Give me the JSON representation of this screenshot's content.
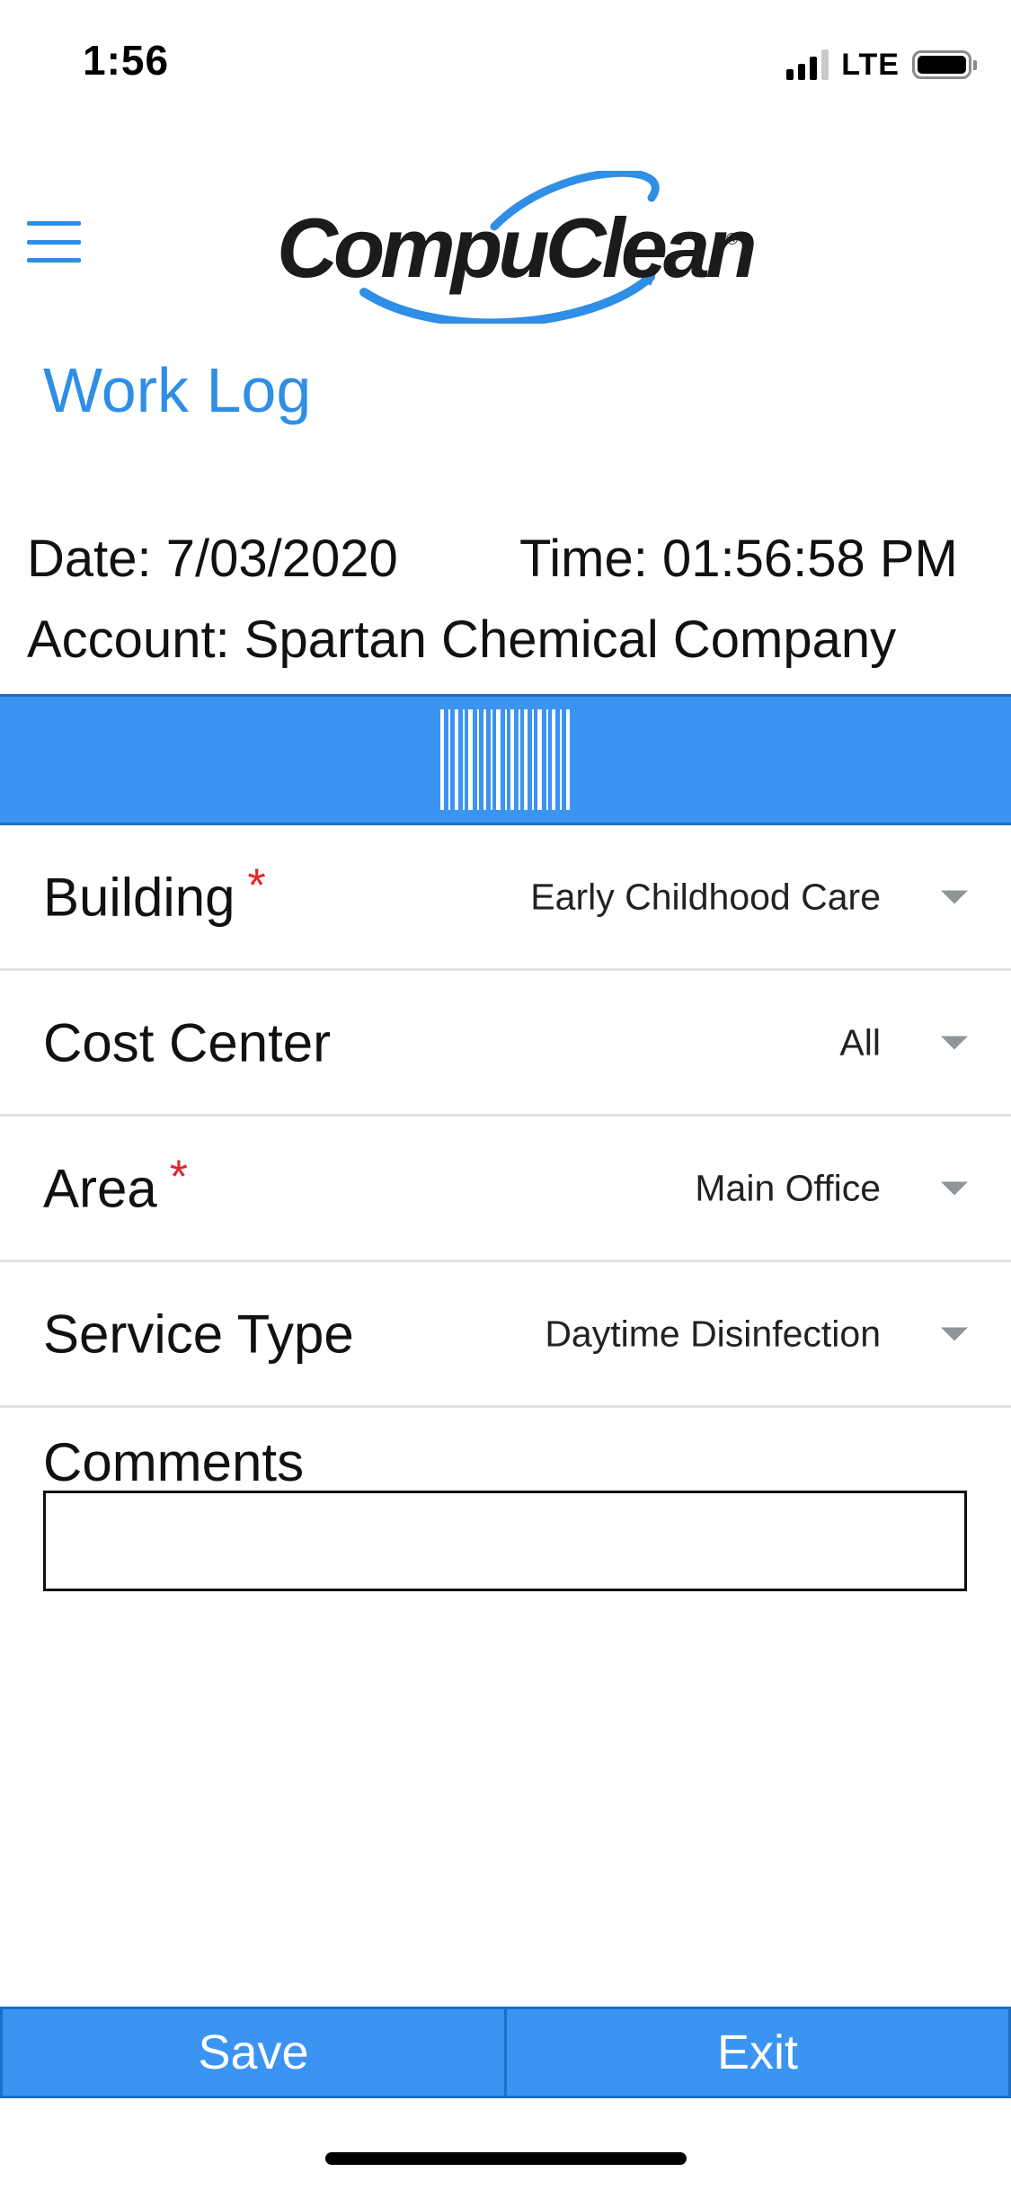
{
  "status_bar": {
    "time": "1:56",
    "network": "LTE",
    "icons": [
      "signal-icon",
      "battery-icon"
    ]
  },
  "header": {
    "menu_icon": "hamburger-menu-icon",
    "logo_text": "CompuClean",
    "logo_mark": "®",
    "title": "Work Log"
  },
  "info": {
    "date_label": "Date: 7/03/2020",
    "time_label": "Time: 01:56:58 PM",
    "account_label": "Account: Spartan Chemical Company"
  },
  "scan_bar": {
    "icon": "barcode-icon"
  },
  "form": {
    "fields": [
      {
        "label": "Building",
        "required": true,
        "required_mark": "*",
        "value": "Early Childhood Care"
      },
      {
        "label": "Cost Center",
        "required": false,
        "required_mark": "",
        "value": "All"
      },
      {
        "label": "Area",
        "required": true,
        "required_mark": "*",
        "value": "Main Office"
      },
      {
        "label": "Service Type",
        "required": false,
        "required_mark": "",
        "value": "Daytime Disinfection"
      }
    ],
    "comments_label": "Comments",
    "comments_value": ""
  },
  "actions": {
    "save_label": "Save",
    "exit_label": "Exit"
  },
  "colors": {
    "accent": "#3b93f2",
    "title_blue": "#2f8ee5",
    "required": "#e0262b"
  }
}
